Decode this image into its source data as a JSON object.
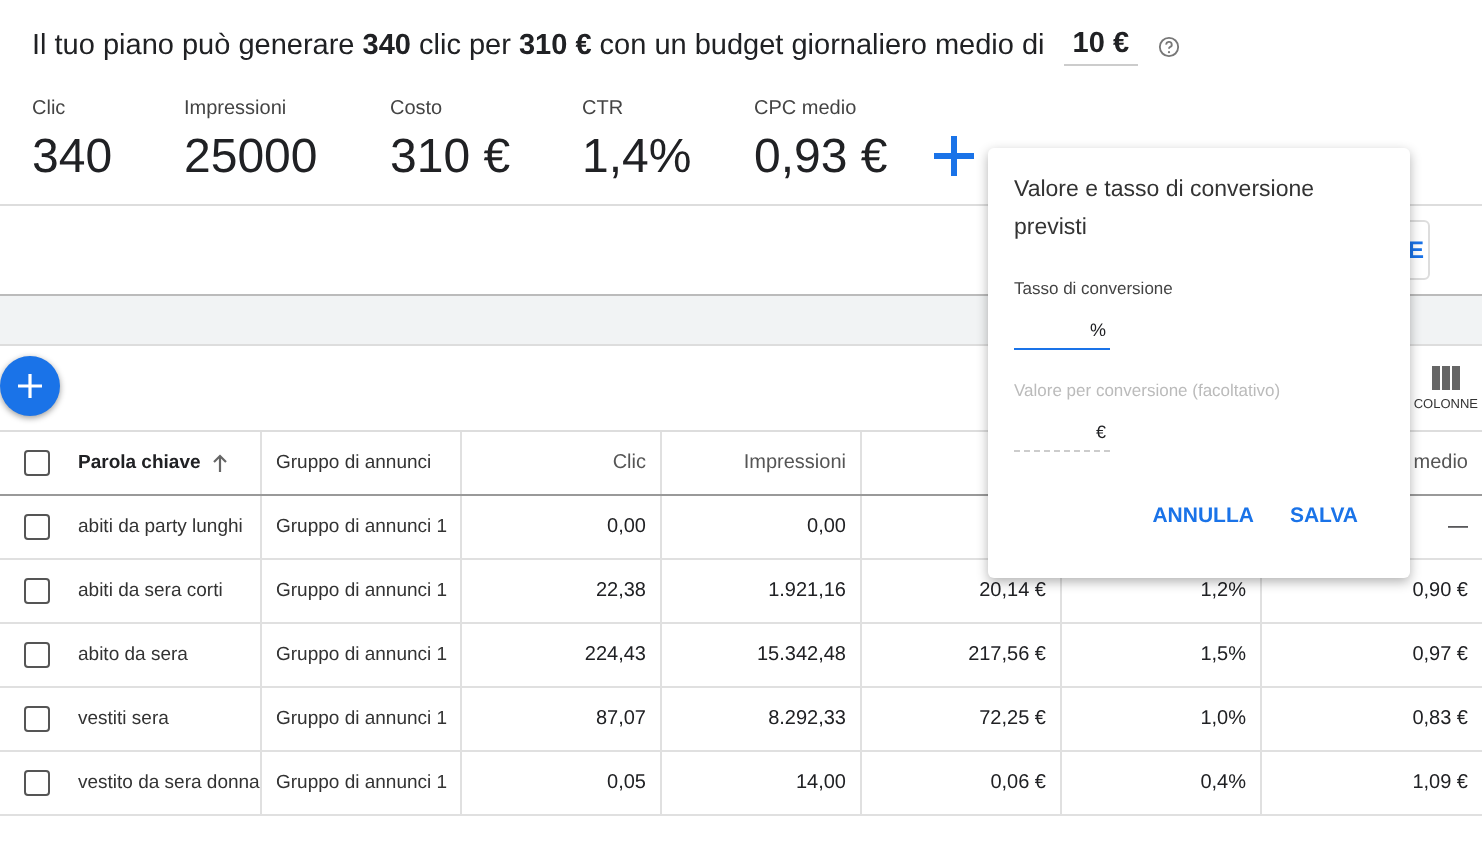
{
  "summary": {
    "sentence": "Il tuo piano può generare **340** clic per **310 €** con un budget giornaliero medio di",
    "budget": "10 €"
  },
  "metrics": [
    {
      "label": "Clic",
      "value": "340"
    },
    {
      "label": "Impressioni",
      "value": "25000"
    },
    {
      "label": "Costo",
      "value": "310 €"
    },
    {
      "label": "CTR",
      "value": "1,4%"
    },
    {
      "label": "CPC medio",
      "value": "0,93 €"
    }
  ],
  "partial_button": "E",
  "columns_button": "COLONNE",
  "table": {
    "all_checked": false,
    "columns": {
      "keyword": {
        "label": "Parola chiave",
        "sorted": true
      },
      "group": "Gruppo di annunci",
      "clic": "Clic",
      "impressioni": "Impressioni",
      "column_7": "medio"
    },
    "rows": [
      {
        "checked": false,
        "keyword": "abiti da party lunghi",
        "group": "Gruppo di annunci 1",
        "clic": "0,00",
        "impressioni": "0,00",
        "column_7": "—"
      },
      {
        "checked": false,
        "keyword": "abiti da sera corti",
        "group": "Gruppo di annunci 1",
        "clic": "22,38",
        "impressioni": "1.921,16",
        "column_5": "20,14 €",
        "column_6": "1,2%",
        "column_7": "0,90 €"
      },
      {
        "checked": false,
        "keyword": "abito da sera",
        "group": "Gruppo di annunci 1",
        "clic": "224,43",
        "impressioni": "15.342,48",
        "column_5": "217,56 €",
        "column_6": "1,5%",
        "column_7": "0,97 €"
      },
      {
        "checked": false,
        "keyword": "vestiti sera",
        "group": "Gruppo di annunci 1",
        "clic": "87,07",
        "impressioni": "8.292,33",
        "column_5": "72,25 €",
        "column_6": "1,0%",
        "column_7": "0,83 €"
      },
      {
        "checked": false,
        "keyword": "vestito da sera donna",
        "group": "Gruppo di annunci 1",
        "clic": "0,05",
        "impressioni": "14,00",
        "column_5": "0,06 €",
        "column_6": "0,4%",
        "column_7": "1,09 €"
      }
    ]
  },
  "popup": {
    "title": "Valore e tasso di conversione previsti",
    "fields": [
      {
        "label": "Tasso di conversione",
        "suffix": "%",
        "disabled": false
      },
      {
        "label": "Valore per conversione (facoltativo)",
        "suffix": "€",
        "disabled": true
      }
    ],
    "buttons": [
      "ANNULLA",
      "SALVA"
    ]
  }
}
